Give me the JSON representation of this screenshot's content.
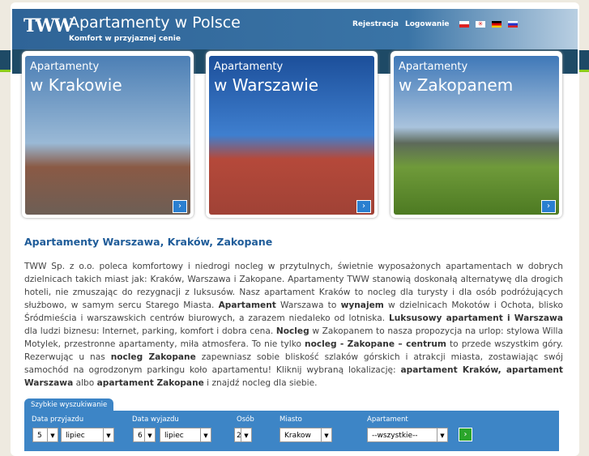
{
  "header": {
    "logo": "TWW",
    "title": "Apartamenty w Polsce",
    "subtitle": "Komfort w przyjaznej cenie",
    "nav": [
      "Rejestracja",
      "Logowanie"
    ],
    "flags": [
      "polish-flag-icon",
      "english-flag-icon",
      "german-flag-icon",
      "russian-flag-icon"
    ]
  },
  "cards": [
    {
      "l1": "Apartamenty",
      "l2": "w Krakowie"
    },
    {
      "l1": "Apartamenty",
      "l2": "w Warszawie"
    },
    {
      "l1": "Apartamenty",
      "l2": "w Zakopanem"
    }
  ],
  "main": {
    "heading": "Apartamenty Warszawa, Kraków, Zakopane",
    "paragraph": [
      [
        "TWW Sp. z o.o. poleca komfortowy i niedrogi nocleg w przytulnych, świetnie wyposażonych apartamentach w dobrych dzielnicach takich miast jak: Kraków, Warszawa i Zakopane. Apartamenty TWW stanowią doskonałą alternatywę dla drogich hoteli, nie zmuszając do rezygnacji z luksusów. Nasz apartament Kraków to nocleg dla turysty i dla osób podróżujących służbowo, w samym sercu Starego Miasta. ",
        false
      ],
      [
        "Apartament",
        true
      ],
      [
        " Warszawa to ",
        false
      ],
      [
        "wynajem",
        true
      ],
      [
        " w dzielnicach Mokotów i Ochota, blisko Śródmieścia i warszawskich centrów biurowych, a zarazem niedaleko od lotniska. ",
        false
      ],
      [
        "Luksusowy apartament i Warszawa",
        true
      ],
      [
        " dla ludzi biznesu: Internet, parking, komfort i dobra cena. ",
        false
      ],
      [
        "Nocleg",
        true
      ],
      [
        " w Zakopanem to nasza propozycja na urlop: stylowa Willa Motylek, przestronne apartamenty, miła atmosfera. To nie tylko ",
        false
      ],
      [
        "nocleg - Zakopane – centrum",
        true
      ],
      [
        " to przede wszystkim góry. Rezerwując u nas ",
        false
      ],
      [
        "nocleg Zakopane",
        true
      ],
      [
        " zapewniasz sobie bliskość szlaków górskich i atrakcji miasta, zostawiając swój samochód na ogrodzonym parkingu koło apartamentu! Kliknij wybraną lokalizację: ",
        false
      ],
      [
        "apartament Kraków, apartament Warszawa",
        true
      ],
      [
        " albo ",
        false
      ],
      [
        "apartament Zakopane",
        true
      ],
      [
        " i znajdź nocleg dla siebie.",
        false
      ]
    ]
  },
  "search": {
    "tab": "Szybkie wyszukiwanie",
    "labels": [
      "Data przyjazdu",
      "Data wyjazdu",
      "Osób",
      "Miasto",
      "Apartament"
    ],
    "arrival_day": "5",
    "arrival_month": "lipiec",
    "departure_day": "6",
    "departure_month": "lipiec",
    "persons": "2",
    "city": "Krakow",
    "apartment": "--wszystkie--",
    "go": "›"
  }
}
